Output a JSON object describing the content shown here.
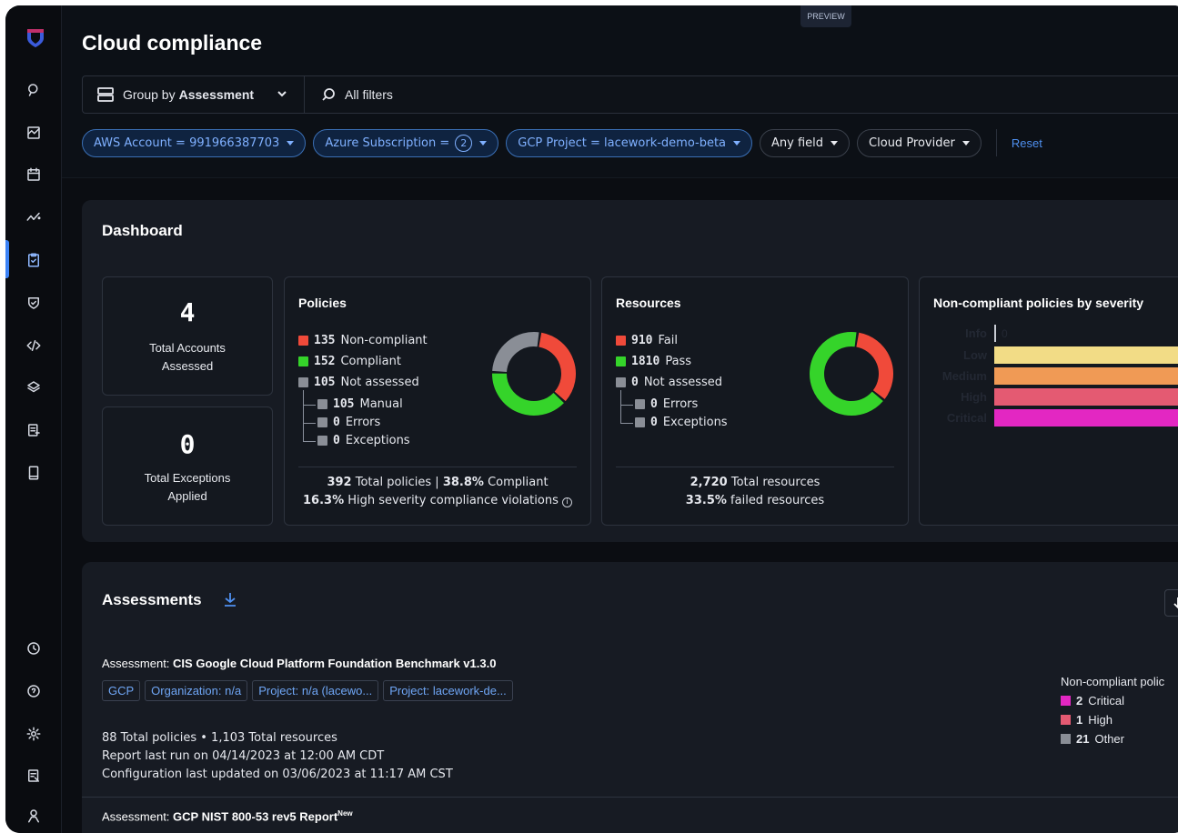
{
  "badge": "PREVIEW",
  "page_title": "Cloud compliance",
  "filterbar": {
    "group_prefix": "Group by",
    "group_value": "Assessment",
    "all_filters": "All filters"
  },
  "chips": [
    {
      "label": "AWS Account = 991966387703"
    },
    {
      "label": "Azure Subscription =",
      "count": "2"
    },
    {
      "label": "GCP Project = lacework-demo-beta"
    },
    {
      "label": "Any field"
    },
    {
      "label": "Cloud Provider"
    }
  ],
  "reset": "Reset",
  "dashboard": {
    "title": "Dashboard",
    "accounts": {
      "value": "4",
      "label_line1": "Total Accounts",
      "label_line2": "Assessed"
    },
    "exceptions": {
      "value": "0",
      "label_line1": "Total Exceptions",
      "label_line2": "Applied"
    },
    "policies": {
      "title": "Policies",
      "noncompliant": {
        "num": "135",
        "text": "Non-compliant"
      },
      "compliant": {
        "num": "152",
        "text": "Compliant"
      },
      "not_assessed": {
        "num": "105",
        "text": "Not assessed"
      },
      "manual": {
        "num": "105",
        "text": "Manual"
      },
      "errors": {
        "num": "0",
        "text": "Errors"
      },
      "exc": {
        "num": "0",
        "text": "Exceptions"
      },
      "summary_num": "392",
      "summary_text": "Total policies",
      "summary_pct": "38.8%",
      "summary_pct_text": "Compliant",
      "high_pct": "16.3%",
      "high_text": "High severity compliance violations",
      "donut": [
        135,
        152,
        105
      ],
      "colors": [
        "#f04a3a",
        "#35d42a",
        "#8a8e96"
      ]
    },
    "resources": {
      "title": "Resources",
      "fail": {
        "num": "910",
        "text": "Fail"
      },
      "pass": {
        "num": "1810",
        "text": "Pass"
      },
      "not_assessed": {
        "num": "0",
        "text": "Not assessed"
      },
      "errors": {
        "num": "0",
        "text": "Errors"
      },
      "exc": {
        "num": "0",
        "text": "Exceptions"
      },
      "total_num": "2,720",
      "total_text": "Total resources",
      "failed_pct": "33.5%",
      "failed_text": "failed resources",
      "donut": [
        910,
        1810
      ],
      "colors": [
        "#f04a3a",
        "#35d42a"
      ]
    },
    "severity": {
      "title": "Non-compliant policies by severity",
      "rows": [
        {
          "label": "Info",
          "value": 0,
          "value_label": "0",
          "color": "#9aa0aa"
        },
        {
          "label": "Low",
          "color": "#f2dc86"
        },
        {
          "label": "Medium",
          "color": "#f09a55"
        },
        {
          "label": "High",
          "color": "#e45a72"
        },
        {
          "label": "Critical",
          "color": "#e327c2"
        }
      ]
    }
  },
  "assessments": {
    "title": "Assessments",
    "items": [
      {
        "prefix": "Assessment:",
        "name": "CIS Google Cloud Platform Foundation Benchmark v1.3.0",
        "tags": [
          "GCP",
          "Organization: n/a",
          "Project: n/a (lacewo...",
          "Project: lacework-de..."
        ],
        "line1": "88 Total policies • 1,103 Total resources",
        "line2": "Report last run on 04/14/2023 at 12:00 AM CDT",
        "line3": "Configuration last updated on 03/06/2023 at 11:17 AM CST",
        "ncp_title": "Non-compliant polic",
        "ncp_rows": [
          {
            "num": "2",
            "text": "Critical",
            "color": "#e327c2"
          },
          {
            "num": "1",
            "text": "High",
            "color": "#e45a72"
          },
          {
            "num": "21",
            "text": "Other",
            "color": "#8a8e96"
          }
        ]
      },
      {
        "prefix": "Assessment:",
        "name": "GCP NIST 800-53 rev5 Report",
        "badge": "New"
      }
    ]
  }
}
